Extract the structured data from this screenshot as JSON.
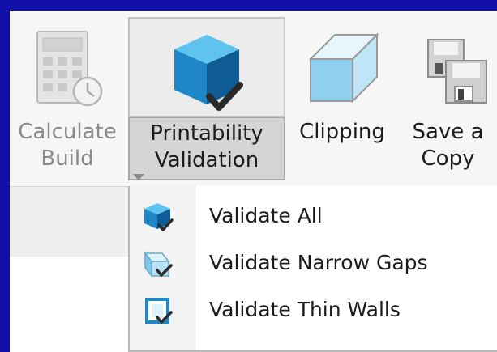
{
  "ribbon": {
    "buttons": [
      {
        "id": "calculate_build",
        "line1": "Calculate",
        "line2": "Build",
        "enabled": false,
        "icon": "calculator-clock-icon"
      },
      {
        "id": "printability_validation",
        "line1": "Printability",
        "line2": "Validation",
        "enabled": true,
        "pressed": true,
        "icon": "cube-check-icon"
      },
      {
        "id": "clipping",
        "line1": "Clipping",
        "line2": "",
        "enabled": true,
        "icon": "clipping-block-icon"
      },
      {
        "id": "save_a_copy",
        "line1": "Save a",
        "line2": "Copy",
        "enabled": true,
        "icon": "floppy-disks-icon"
      }
    ]
  },
  "dropdown": {
    "items": [
      {
        "label": "Validate All",
        "icon": "cube-check-icon"
      },
      {
        "label": "Validate Narrow Gaps",
        "icon": "narrow-gaps-check-icon"
      },
      {
        "label": "Validate Thin Walls",
        "icon": "thin-walls-check-icon"
      }
    ]
  },
  "colors": {
    "background": "#1010a8",
    "ribbon": "#f6f6f6",
    "pressed_button": "#d5d5d5",
    "cube_blue": "#1e8fd0",
    "disabled_text": "#8a8a8a"
  }
}
